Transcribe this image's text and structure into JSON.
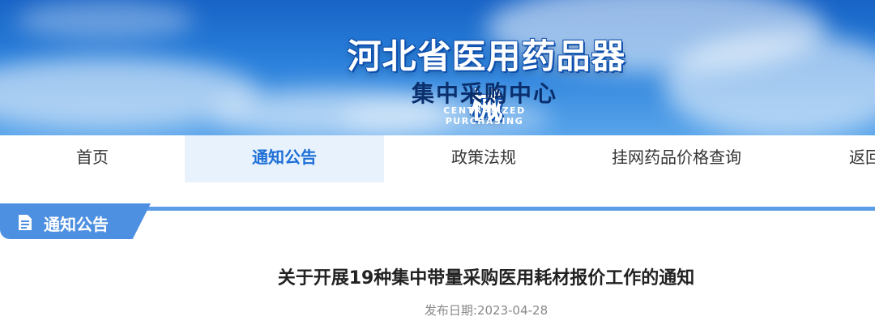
{
  "banner": {
    "title": "河北省医用药品器械",
    "subtitle": "集中采购中心",
    "english": "CENTRALIZED PURCHASING"
  },
  "nav": {
    "items": [
      {
        "label": "首页"
      },
      {
        "label": "通知公告",
        "active": true
      },
      {
        "label": "政策法规"
      },
      {
        "label": "挂网药品价格查询"
      },
      {
        "label": "返回"
      }
    ]
  },
  "section": {
    "label": "通知公告",
    "icon": "document-icon"
  },
  "article": {
    "title": "关于开展19种集中带量采购医用耗材报价工作的通知",
    "date_label": "发布日期:",
    "date": "2023-04-28"
  },
  "colors": {
    "accent": "#1d6fd6",
    "section_bar": "#4d8fe0",
    "nav_active_bg": "#e8f2fd"
  }
}
